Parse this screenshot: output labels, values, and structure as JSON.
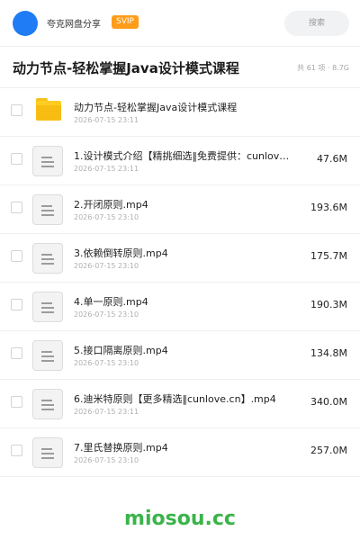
{
  "header": {
    "brand": "夸克网盘分享",
    "badge": "SVIP",
    "search_placeholder": "搜索",
    "accent": "#1f7cf5",
    "badge_color": "#ff9c1a"
  },
  "share": {
    "title": "动力节点-轻松掌握Java设计模式课程",
    "summary": "共 61 项 · 8.7G"
  },
  "files": [
    {
      "type": "folder",
      "icon": "folder-icon",
      "name": "动力节点-轻松掌握Java设计模式课程",
      "date": "2026-07-15 23:11",
      "size": ""
    },
    {
      "type": "file",
      "icon": "file-icon",
      "name": "1.设计模式介绍【精挑细选‖免费提供：cunlove.cn】.mp4",
      "date": "2026-07-15 23:11",
      "size": "47.6M"
    },
    {
      "type": "file",
      "icon": "file-icon",
      "name": "2.开闭原则.mp4",
      "date": "2026-07-15 23:10",
      "size": "193.6M"
    },
    {
      "type": "file",
      "icon": "file-icon",
      "name": "3.依赖倒转原则.mp4",
      "date": "2026-07-15 23:10",
      "size": "175.7M"
    },
    {
      "type": "file",
      "icon": "file-icon",
      "name": "4.单一原则.mp4",
      "date": "2026-07-15 23:10",
      "size": "190.3M"
    },
    {
      "type": "file",
      "icon": "file-icon",
      "name": "5.接口隔离原则.mp4",
      "date": "2026-07-15 23:10",
      "size": "134.8M"
    },
    {
      "type": "file",
      "icon": "file-icon",
      "name": "6.迪米特原则【更多精选‖cunlove.cn】.mp4",
      "date": "2026-07-15 23:11",
      "size": "340.0M"
    },
    {
      "type": "file",
      "icon": "file-icon",
      "name": "7.里氏替换原则.mp4",
      "date": "2026-07-15 23:10",
      "size": "257.0M"
    }
  ],
  "watermark": "miosou.cc"
}
